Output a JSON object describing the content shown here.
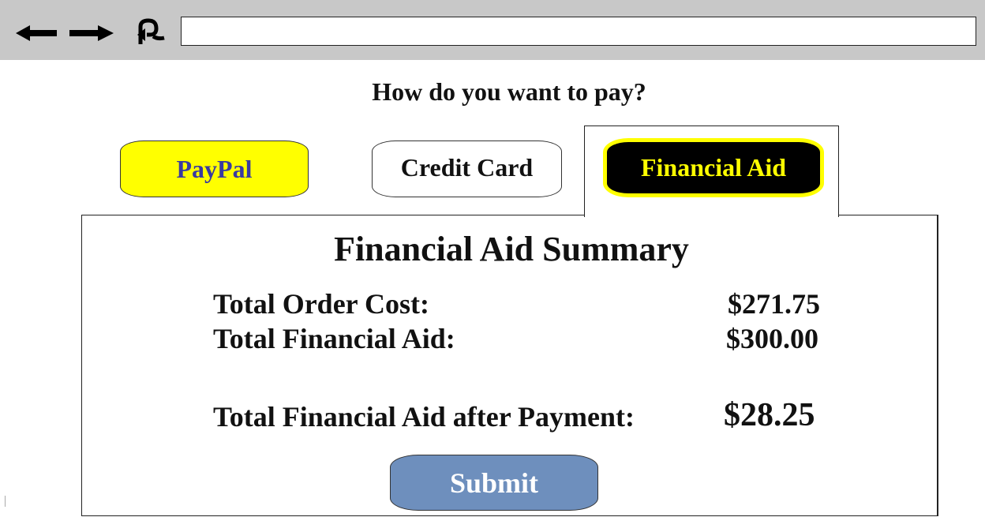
{
  "browser": {
    "url_value": "",
    "back_icon": "arrow-left-icon",
    "forward_icon": "arrow-right-icon",
    "refresh_icon": "refresh-icon"
  },
  "page": {
    "question": "How do you want to pay?",
    "payment_options": {
      "paypal_label": "PayPal",
      "credit_card_label": "Credit Card",
      "financial_aid_label": "Financial Aid"
    },
    "selected_option": "Financial Aid",
    "summary": {
      "title": "Financial Aid Summary",
      "total_order_cost_label": "Total Order Cost:",
      "total_order_cost_value": "$271.75",
      "total_financial_aid_label": "Total Financial Aid:",
      "total_financial_aid_value": "$300.00",
      "aid_after_payment_label": "Total Financial Aid after Payment:",
      "aid_after_payment_value": "$28.25"
    },
    "submit_label": "Submit"
  },
  "colors": {
    "toolbar": "#c8c8c8",
    "paypal_bg": "#ffff00",
    "paypal_text": "#3a3aa0",
    "aid_bg": "#000000",
    "aid_accent": "#ffff00",
    "submit_bg": "#6e8fbd"
  }
}
